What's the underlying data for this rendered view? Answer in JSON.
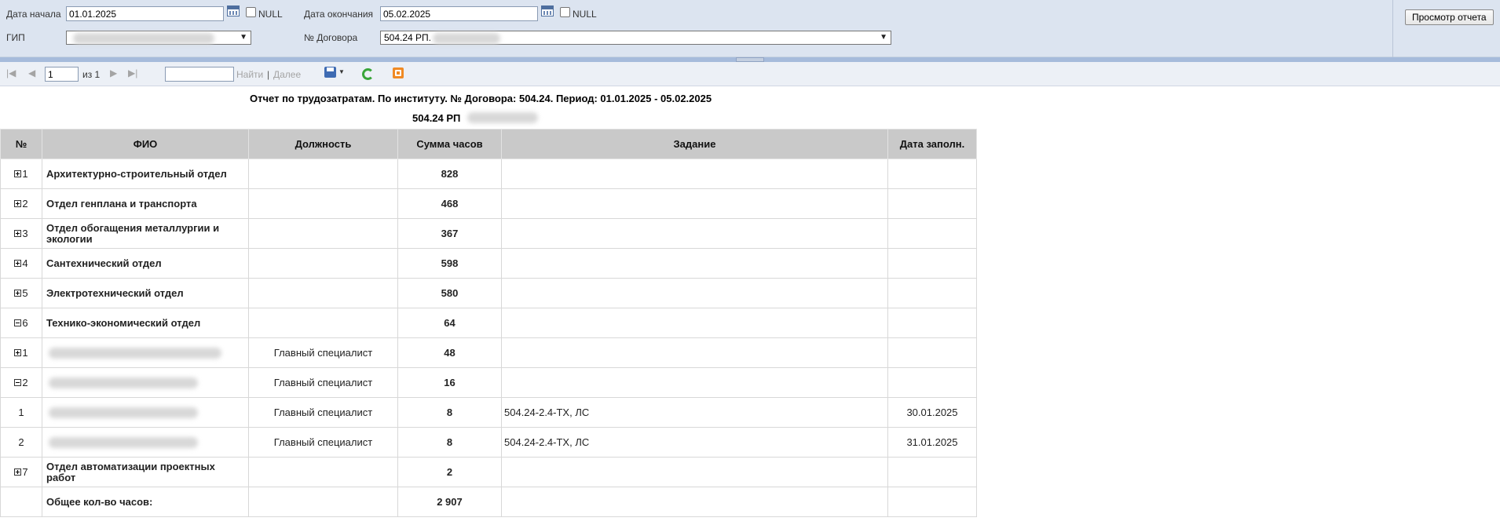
{
  "params": {
    "start_label": "Дата начала",
    "start_value": "01.01.2025",
    "start_null_label": "NULL",
    "end_label": "Дата окончания",
    "end_value": "05.02.2025",
    "end_null_label": "NULL",
    "gip_label": "ГИП",
    "contract_label": "№ Договора",
    "contract_value": "504.24 РП.",
    "view_report_label": "Просмотр отчета"
  },
  "toolbar": {
    "page_value": "1",
    "page_of": "из 1",
    "find_label": "Найти",
    "separator": "|",
    "next_label": "Далее",
    "first_icon": "first-page-icon",
    "prev_icon": "prev-page-icon",
    "next_icon": "next-page-icon",
    "last_icon": "last-page-icon",
    "export_icon": "save-export-icon",
    "refresh_icon": "refresh-icon",
    "atom_icon": "atom-feed-icon"
  },
  "report": {
    "title": "Отчет по трудозатратам. По институту. № Договора: 504.24. Период: 01.01.2025 - 05.02.2025",
    "subtitle": "504.24 РП",
    "columns": [
      "№",
      "ФИО",
      "Должность",
      "Сумма часов",
      "Задание",
      "Дата заполн."
    ],
    "rows": [
      {
        "expander": "plus",
        "num": "1",
        "fio": "Архитектурно-строительный отдел",
        "position": "",
        "hours": "828",
        "task": "",
        "date": ""
      },
      {
        "expander": "plus",
        "num": "2",
        "fio": "Отдел генплана и транспорта",
        "position": "",
        "hours": "468",
        "task": "",
        "date": ""
      },
      {
        "expander": "plus",
        "num": "3",
        "fio": "Отдел обогащения металлургии и экологии",
        "position": "",
        "hours": "367",
        "task": "",
        "date": ""
      },
      {
        "expander": "plus",
        "num": "4",
        "fio": "Сантехнический отдел",
        "position": "",
        "hours": "598",
        "task": "",
        "date": ""
      },
      {
        "expander": "plus",
        "num": "5",
        "fio": "Электротехнический отдел",
        "position": "",
        "hours": "580",
        "task": "",
        "date": ""
      },
      {
        "expander": "minus",
        "num": "6",
        "fio": "Технико-экономический отдел",
        "position": "",
        "hours": "64",
        "task": "",
        "date": ""
      },
      {
        "expander": "plus",
        "num": "1",
        "fio": "",
        "position": "Главный специалист",
        "hours": "48",
        "task": "",
        "date": ""
      },
      {
        "expander": "minus",
        "num": "2",
        "fio": "",
        "position": "Главный специалист",
        "hours": "16",
        "task": "",
        "date": ""
      },
      {
        "expander": "",
        "num": "1",
        "fio": "",
        "position": "Главный специалист",
        "hours": "8",
        "task": "504.24-2.4-ТХ, ЛС",
        "date": "30.01.2025"
      },
      {
        "expander": "",
        "num": "2",
        "fio": "",
        "position": "Главный специалист",
        "hours": "8",
        "task": "504.24-2.4-ТХ, ЛС",
        "date": "31.01.2025"
      },
      {
        "expander": "plus",
        "num": "7",
        "fio": "Отдел автоматизации проектных работ",
        "position": "",
        "hours": "2",
        "task": "",
        "date": ""
      }
    ],
    "total_label": "Общее кол-во часов:",
    "total_value": "2 907"
  }
}
